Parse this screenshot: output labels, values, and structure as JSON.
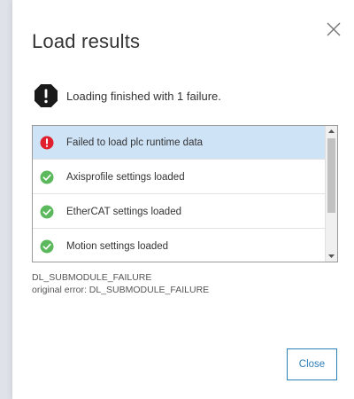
{
  "dialog": {
    "title": "Load results",
    "summary_icon": "alert-octagon-icon",
    "summary_text": "Loading finished with 1 failure.",
    "close_icon": "close-icon"
  },
  "results": {
    "items": [
      {
        "status": "error",
        "icon": "error-circle-icon",
        "label": "Failed to load plc runtime data",
        "selected": true
      },
      {
        "status": "success",
        "icon": "check-circle-icon",
        "label": "Axisprofile settings loaded",
        "selected": false
      },
      {
        "status": "success",
        "icon": "check-circle-icon",
        "label": "EtherCAT settings loaded",
        "selected": false
      },
      {
        "status": "success",
        "icon": "check-circle-icon",
        "label": "Motion settings loaded",
        "selected": false
      }
    ]
  },
  "error_details": {
    "code": "DL_SUBMODULE_FAILURE",
    "original": "original error: DL_SUBMODULE_FAILURE"
  },
  "footer": {
    "close_label": "Close"
  },
  "colors": {
    "accent": "#2d7fb8",
    "error": "#e0202e",
    "success": "#5cb85c",
    "selected_row": "#cfe3f7",
    "alert_octagon": "#1a1a1a"
  }
}
